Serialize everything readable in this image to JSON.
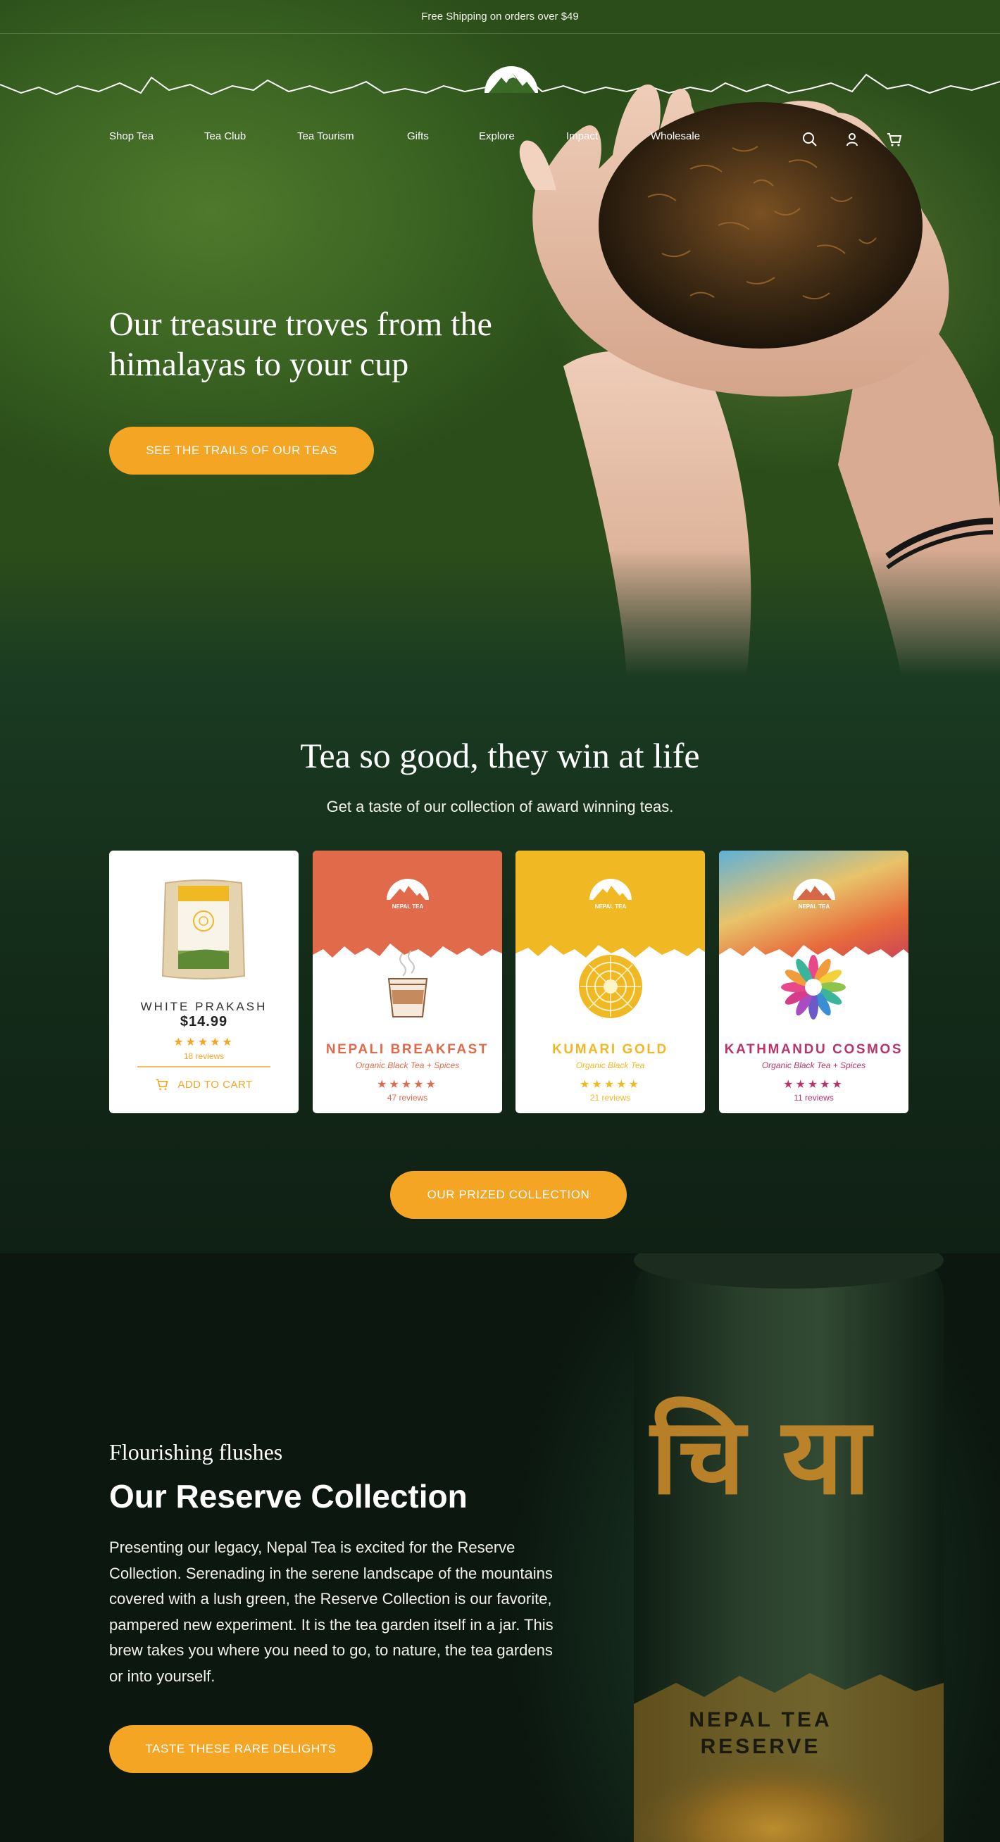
{
  "topbar": {
    "text": "Free Shipping on orders over $49"
  },
  "nav": {
    "items": [
      "Shop Tea",
      "Tea Club",
      "Tea Tourism",
      "Gifts",
      "Explore",
      "Impact",
      "Wholesale"
    ],
    "icons": [
      "search-icon",
      "user-icon",
      "cart-icon"
    ]
  },
  "hero": {
    "title": "Our treasure troves from the himalayas to your cup",
    "cta": "SEE THE TRAILS OF OUR TEAS"
  },
  "awards": {
    "title": "Tea so good, they win at life",
    "subtitle": "Get a taste of our collection of  award winning teas.",
    "cards": [
      {
        "name": "WHITE PRAKASH",
        "price": "$14.99",
        "stars": "★★★★★",
        "reviews": "18 reviews",
        "cta": "ADD TO CART"
      },
      {
        "brand": "NEPAL TEA",
        "name": "NEPALI BREAKFAST",
        "desc": "Organic Black Tea + Spices",
        "stars": "★★★★★",
        "reviews": "47 reviews",
        "color": "#e06a4a"
      },
      {
        "brand": "NEPAL TEA",
        "name": "KUMARI GOLD",
        "desc": "Organic Black Tea",
        "stars": "★★★★★",
        "reviews": "21 reviews",
        "color": "#f0b822"
      },
      {
        "brand": "NEPAL TEA",
        "name": "KATHMANDU COSMOS",
        "desc": "Organic Black Tea + Spices",
        "stars": "★★★★★",
        "reviews": "11 reviews",
        "color": "#b8336a"
      }
    ],
    "cta": "OUR PRIZED COLLECTION"
  },
  "reserve": {
    "kicker": "Flourishing flushes",
    "title": "Our Reserve Collection",
    "text": "Presenting our legacy, Nepal Tea is excited for the Reserve Collection. Serenading in the serene landscape of the mountains covered with a lush green, the Reserve Collection is our favorite, pampered new experiment. It is the tea garden itself in a jar. This brew takes you where you need to go, to nature, the tea gardens or into yourself.",
    "cta": "TASTE THESE RARE DELIGHTS",
    "jar_script": "चि या",
    "jar_label_1": "NEPAL TEA",
    "jar_label_2": "RESERVE"
  },
  "colors": {
    "accent": "#f5a524",
    "forest": "#1b3b22",
    "dark": "#0b170f"
  }
}
